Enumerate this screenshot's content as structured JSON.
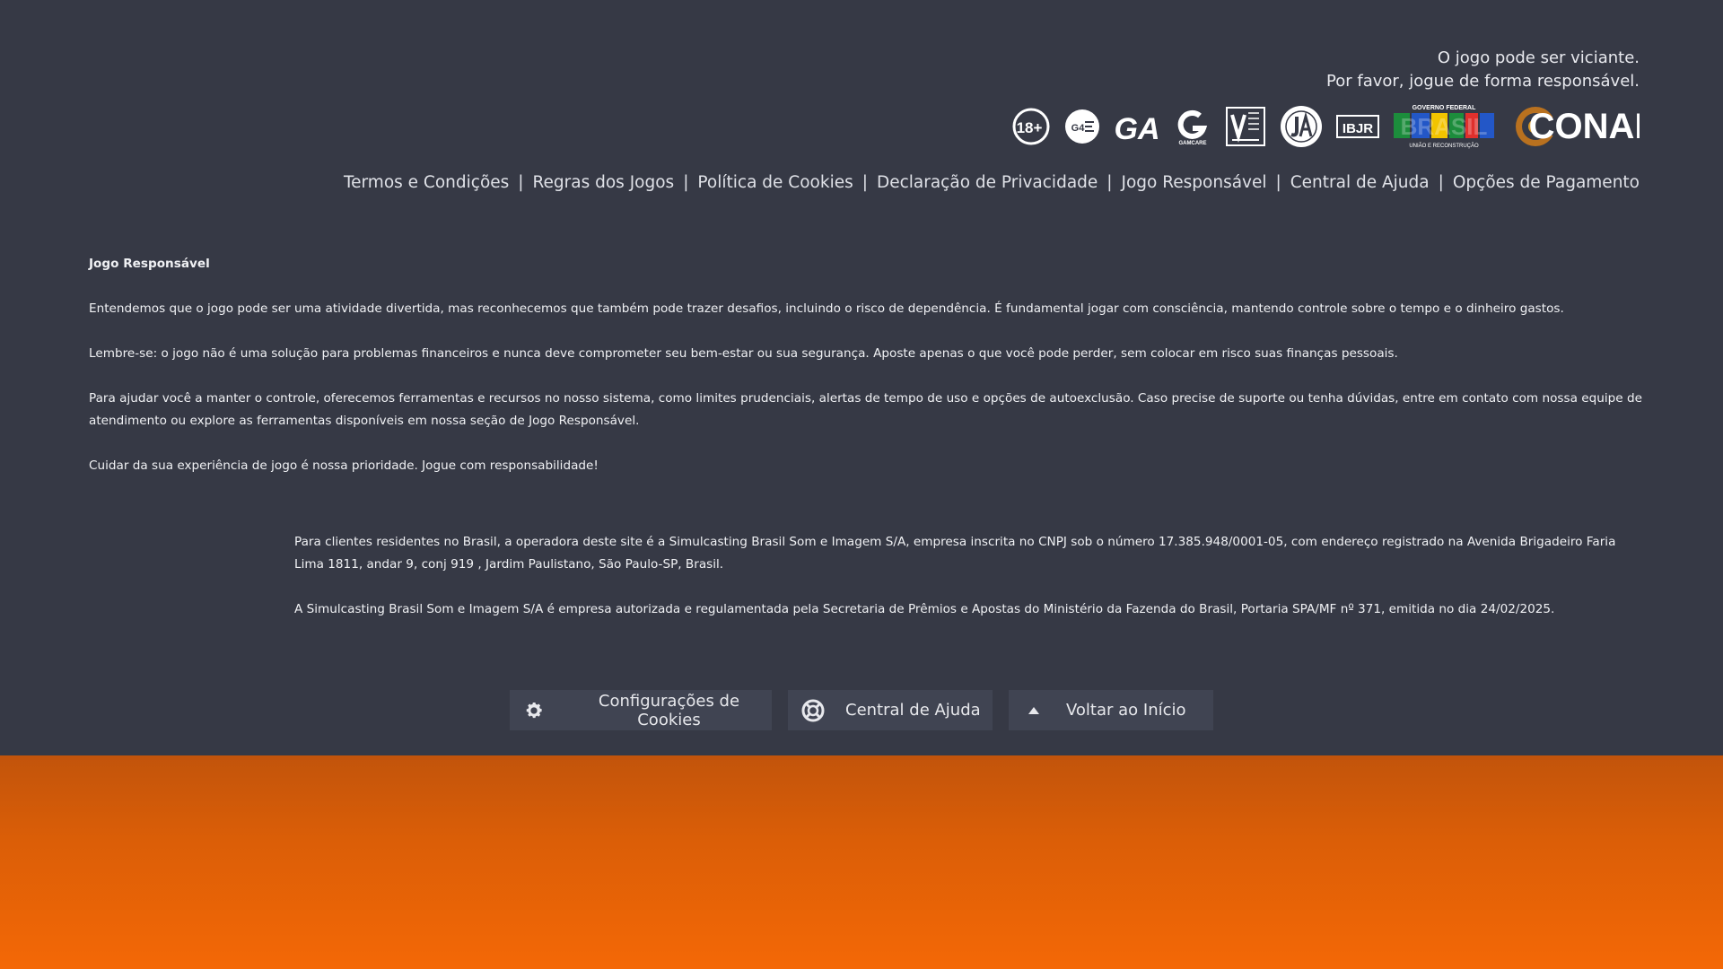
{
  "warning": {
    "line1": "O jogo pode ser viciante.",
    "line2": "Por favor, jogue de forma responsável."
  },
  "logos": {
    "age": "18+",
    "g4": "G4",
    "ga": "GA",
    "gamcare": "GAMCARE",
    "ibjr": "IBJR",
    "gov_top": "GOVERNO FEDERAL",
    "gov_main": "BRASIL",
    "gov_bottom": "UNIÃO E RECONSTRUÇÃO",
    "conar": "CONAR"
  },
  "nav": {
    "items": [
      "Termos e Condições",
      "Regras dos Jogos",
      "Política de Cookies",
      "Declaração de Privacidade",
      "Jogo Responsável",
      "Central de Ajuda",
      "Opções de Pagamento"
    ],
    "separator": "|"
  },
  "responsible": {
    "title": "Jogo Responsável",
    "p1": "Entendemos que o jogo pode ser uma atividade divertida, mas reconhecemos que também pode trazer desafios, incluindo o risco de dependência. É fundamental jogar com consciência, mantendo controle sobre o tempo e o dinheiro gastos.",
    "p2": "Lembre-se: o jogo não é uma solução para problemas financeiros e nunca deve comprometer seu bem-estar ou sua segurança. Aposte apenas o que você pode perder, sem colocar em risco suas finanças pessoais.",
    "p3": "Para ajudar você a manter o controle, oferecemos ferramentas e recursos no nosso sistema, como limites prudenciais, alertas de tempo de uso e opções de autoexclusão. Caso precise de suporte ou tenha dúvidas, entre em contato com nossa equipe de atendimento ou explore as ferramentas disponíveis em nossa seção de Jogo Responsável.",
    "p4": "Cuidar da sua experiência de jogo é nossa prioridade. Jogue com responsabilidade!"
  },
  "legal": {
    "p1": "Para clientes residentes no Brasil, a operadora deste site é a Simulcasting Brasil Som e Imagem S/A, empresa inscrita no CNPJ sob o número 17.385.948/0001-05, com endereço registrado na Avenida Brigadeiro Faria Lima 1811, andar 9, conj 919 , Jardim Paulistano, São Paulo-SP, Brasil.",
    "p2": "A Simulcasting Brasil Som e Imagem S/A é empresa autorizada e regulamentada pela Secretaria de Prêmios e Apostas do Ministério da Fazenda do Brasil, Portaria SPA/MF nº 371, emitida no dia 24/02/2025."
  },
  "buttons": {
    "cookies": "Configurações de Cookies",
    "help": "Central de Ajuda",
    "top": "Voltar ao Início"
  },
  "colors": {
    "background": "#363945",
    "button_bg": "#404452",
    "orange_top": "#c2540b",
    "orange_bottom": "#f46806"
  }
}
